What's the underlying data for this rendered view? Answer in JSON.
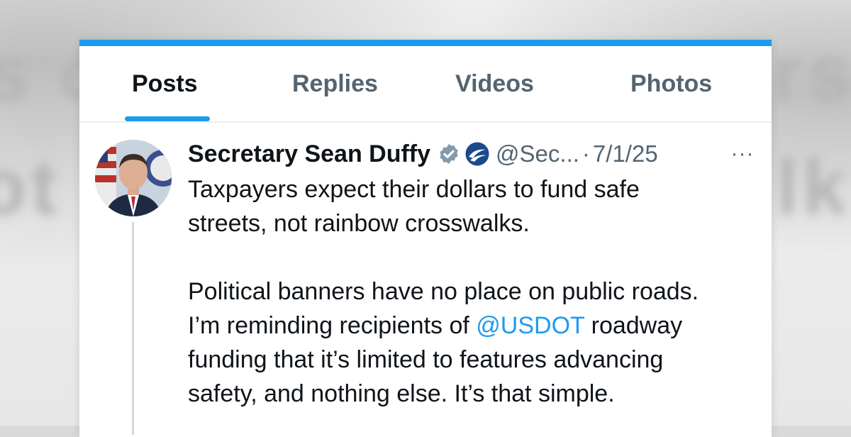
{
  "tabs": [
    {
      "label": "Posts",
      "active": true
    },
    {
      "label": "Replies",
      "active": false
    },
    {
      "label": "Videos",
      "active": false
    },
    {
      "label": "Photos",
      "active": false
    }
  ],
  "post": {
    "author_name": "Secretary Sean Duffy",
    "handle": "@Sec...",
    "separator": "·",
    "date": "7/1/25",
    "paragraph1": "Taxpayers expect their dollars to fund safe\nstreets, not rainbow crosswalks.",
    "paragraph2_before": "Political banners have no place on public roads.\nI’m reminding recipients of ",
    "mention": "@USDOT",
    "paragraph2_after": " roadway\nfunding that it’s limited to features advancing\nsafety, and nothing else. It’s that simple.",
    "more_label": "···"
  },
  "icons": {
    "verified": "verified-badge-icon",
    "agency": "usdot-logo-icon",
    "more": "more-options-icon"
  },
  "colors": {
    "accent": "#1d9bf0",
    "verified_badge": "#829aab",
    "text_primary": "#0f1419",
    "text_secondary": "#536471"
  }
}
